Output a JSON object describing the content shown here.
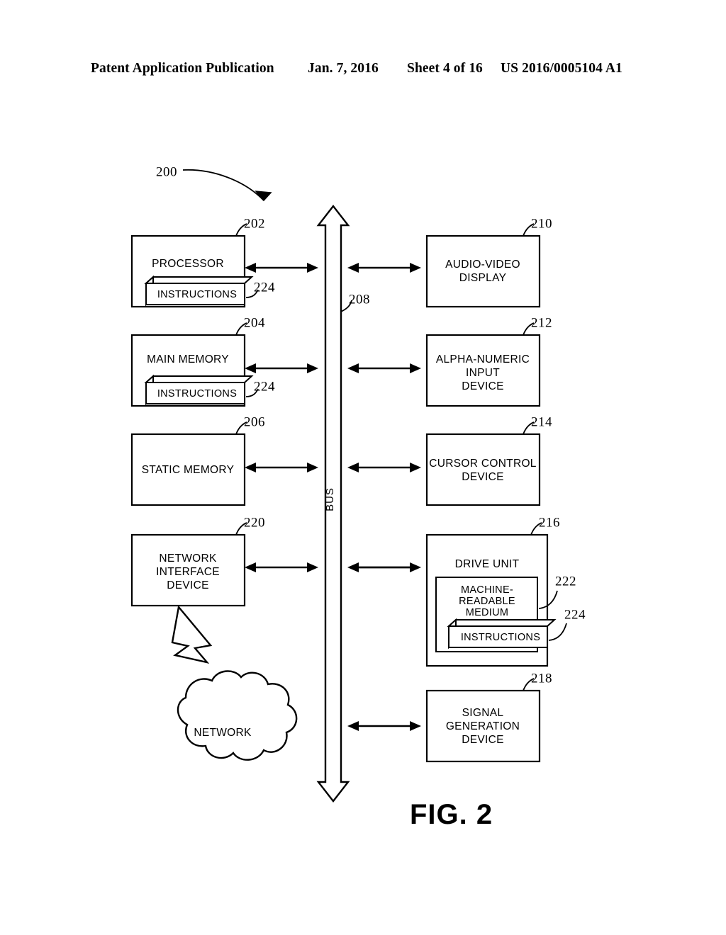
{
  "header": {
    "publication": "Patent Application Publication",
    "date": "Jan. 7, 2016",
    "sheet": "Sheet 4 of 16",
    "patent_number": "US 2016/0005104 A1"
  },
  "figure": {
    "caption": "FIG. 2",
    "system_ref": "200",
    "bus": {
      "label": "BUS",
      "ref": "208"
    },
    "left_column": [
      {
        "id": "processor",
        "label": "PROCESSOR",
        "ref": "202",
        "sub_block": {
          "label": "INSTRUCTIONS",
          "ref": "224"
        }
      },
      {
        "id": "main-memory",
        "label": "MAIN MEMORY",
        "ref": "204",
        "sub_block": {
          "label": "INSTRUCTIONS",
          "ref": "224"
        }
      },
      {
        "id": "static-memory",
        "label": "STATIC MEMORY",
        "ref": "206",
        "sub_block": null
      },
      {
        "id": "network-interface-device",
        "label_lines": [
          "NETWORK",
          "INTERFACE",
          "DEVICE"
        ],
        "ref": "220",
        "sub_block": null
      }
    ],
    "right_column": [
      {
        "id": "audio-video-display",
        "label_lines": [
          "AUDIO-VIDEO",
          "DISPLAY"
        ],
        "ref": "210"
      },
      {
        "id": "alpha-numeric-input-device",
        "label_lines": [
          "ALPHA-NUMERIC",
          "INPUT",
          "DEVICE"
        ],
        "ref": "212"
      },
      {
        "id": "cursor-control-device",
        "label_lines": [
          "CURSOR CONTROL",
          "DEVICE"
        ],
        "ref": "214"
      },
      {
        "id": "drive-unit",
        "label": "DRIVE UNIT",
        "ref": "216",
        "medium": {
          "label_lines": [
            "MACHINE-",
            "READABLE",
            "MEDIUM"
          ],
          "ref": "222",
          "sub_block": {
            "label": "INSTRUCTIONS",
            "ref": "224"
          }
        }
      },
      {
        "id": "signal-generation-device",
        "label_lines": [
          "SIGNAL",
          "GENERATION",
          "DEVICE"
        ],
        "ref": "218"
      }
    ],
    "network_cloud": {
      "label": "NETWORK"
    }
  }
}
